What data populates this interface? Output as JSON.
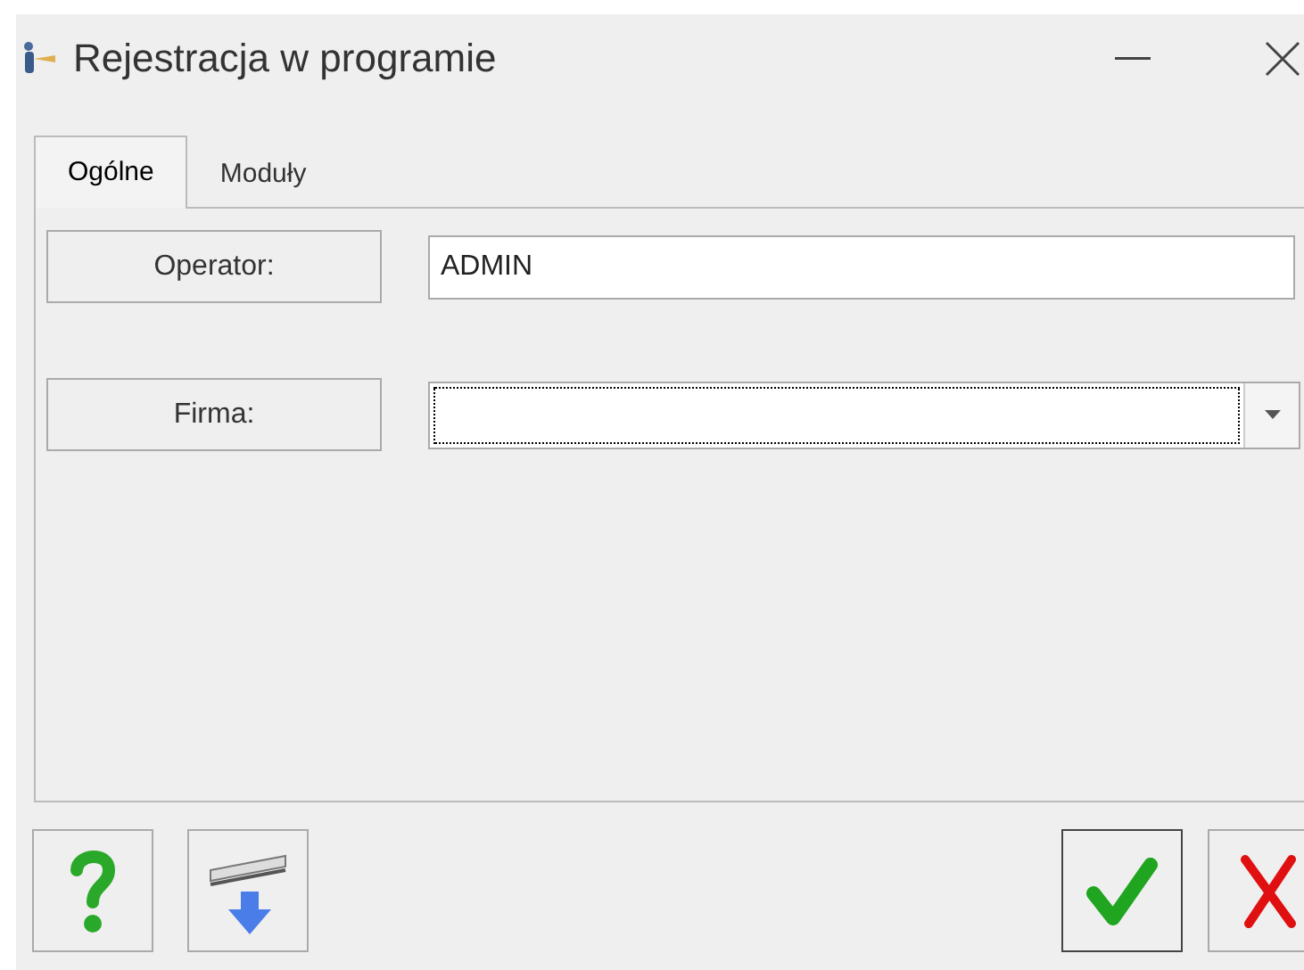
{
  "window": {
    "title": "Rejestracja w programie"
  },
  "tabs": [
    {
      "label": "Ogólne",
      "selected": true
    },
    {
      "label": "Moduły",
      "selected": false
    }
  ],
  "fields": [
    {
      "kind": "text",
      "label": "Operator:",
      "value": "ADMIN",
      "focused": false
    },
    {
      "kind": "combo",
      "label": "Firma:",
      "focused": true
    }
  ]
}
